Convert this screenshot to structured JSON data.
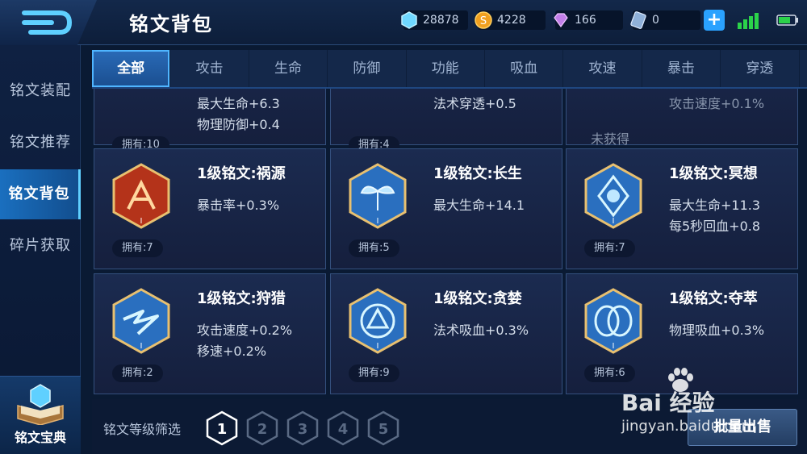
{
  "header": {
    "title": "铭文背包",
    "resources": [
      {
        "icon": "crystal-icon",
        "value": "28878"
      },
      {
        "icon": "gold-coin-icon",
        "value": "4228"
      },
      {
        "icon": "diamond-icon",
        "value": "166"
      },
      {
        "icon": "ticket-icon",
        "value": "0"
      }
    ],
    "add_label": "+"
  },
  "sidebar": {
    "items": [
      {
        "label": "铭文装配"
      },
      {
        "label": "铭文推荐"
      },
      {
        "label": "铭文背包",
        "active": true
      },
      {
        "label": "碎片获取"
      }
    ],
    "book_label": "铭文宝典"
  },
  "tabs": [
    {
      "label": "全部",
      "active": true
    },
    {
      "label": "攻击"
    },
    {
      "label": "生命"
    },
    {
      "label": "防御"
    },
    {
      "label": "功能"
    },
    {
      "label": "吸血"
    },
    {
      "label": "攻速"
    },
    {
      "label": "暴击"
    },
    {
      "label": "穿透"
    }
  ],
  "cards": [
    {
      "name": "",
      "stats": [
        "最大生命+6.3",
        "物理防御+0.4"
      ],
      "owned": "拥有:10",
      "partial": true
    },
    {
      "name": "",
      "stats": [
        "法术穿透+0.5"
      ],
      "owned": "拥有:4",
      "partial": true
    },
    {
      "name": "",
      "stats": [
        "攻击速度+0.1%"
      ],
      "missing": "未获得",
      "partial": true
    },
    {
      "name": "1级铭文:祸源",
      "stats": [
        "暴击率+0.3%"
      ],
      "owned": "拥有:7",
      "color": "#c23a1c"
    },
    {
      "name": "1级铭文:长生",
      "stats": [
        "最大生命+14.1"
      ],
      "owned": "拥有:5",
      "color": "#2a6fbf"
    },
    {
      "name": "1级铭文:冥想",
      "stats": [
        "最大生命+11.3",
        "每5秒回血+0.8"
      ],
      "owned": "拥有:7",
      "color": "#2a6fbf"
    },
    {
      "name": "1级铭文:狩猎",
      "stats": [
        "攻击速度+0.2%",
        "移速+0.2%"
      ],
      "owned": "拥有:2",
      "color": "#2a6fbf"
    },
    {
      "name": "1级铭文:贪婪",
      "stats": [
        "法术吸血+0.3%"
      ],
      "owned": "拥有:9",
      "color": "#2a6fbf"
    },
    {
      "name": "1级铭文:夺萃",
      "stats": [
        "物理吸血+0.3%"
      ],
      "owned": "拥有:6",
      "color": "#2a6fbf"
    }
  ],
  "footer": {
    "filter_label": "铭文等级筛选",
    "levels": [
      "1",
      "2",
      "3",
      "4",
      "5"
    ],
    "selected_level": "1",
    "sell_label": "批量出售"
  },
  "watermark": {
    "brand": "Bai 经验",
    "url": "jingyan.baidu.com"
  }
}
